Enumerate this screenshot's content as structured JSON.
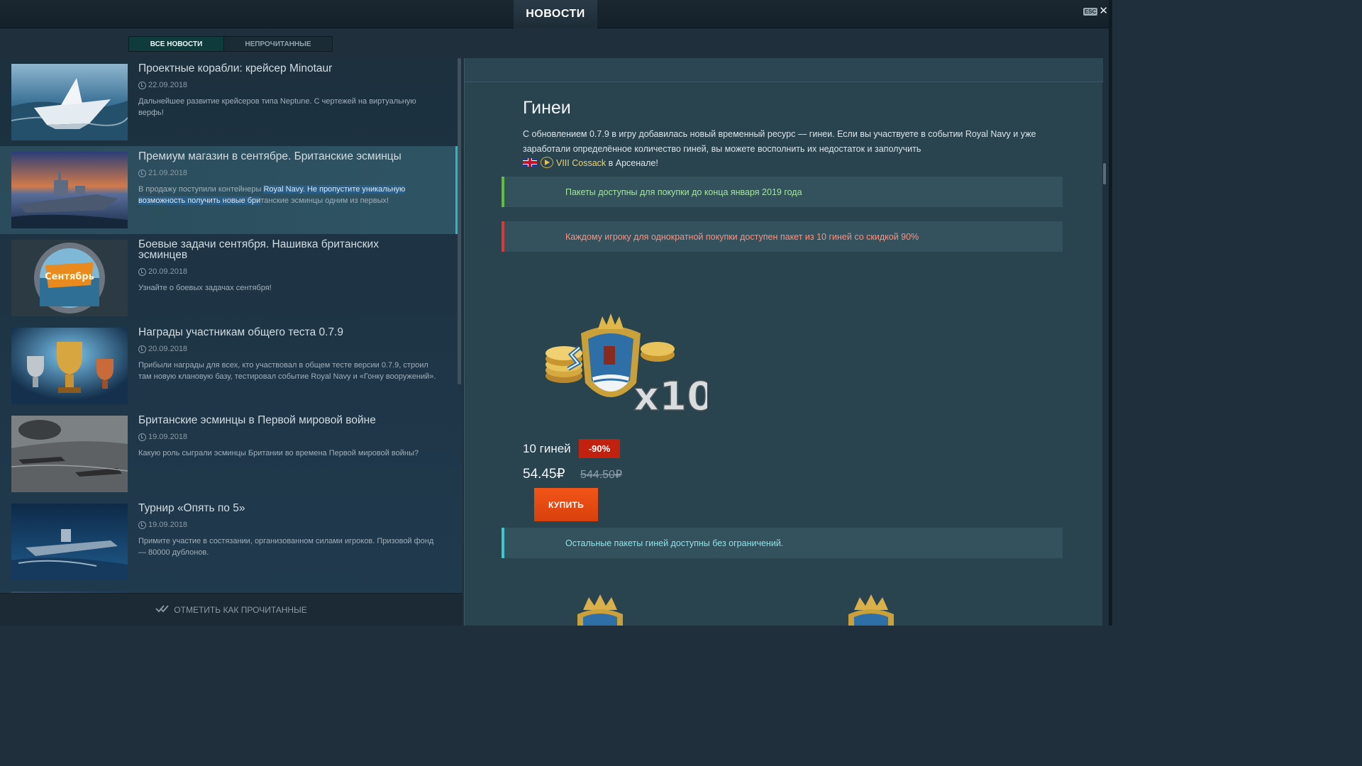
{
  "header": {
    "title": "НОВОСТИ",
    "esc": "ESC"
  },
  "tabs": [
    {
      "label": "ВСЕ НОВОСТИ",
      "active": true
    },
    {
      "label": "НЕПРОЧИТАННЫЕ",
      "active": false
    }
  ],
  "news": [
    {
      "title": "Проектные корабли: крейсер Minotaur",
      "date": "22.09.2018",
      "desc": "Дальнейшее развитие крейсеров типа Neptune. С чертежей на виртуальную верфь!"
    },
    {
      "title": "Премиум магазин в сентябре. Британские эсминцы",
      "date": "21.09.2018",
      "desc_plain": "В продажу поступили контейнеры ",
      "desc_highlight": "Royal Navy. Не пропустите уникальную возможность получить новые бри",
      "desc_rest": "танские эсминцы одним из первых!",
      "selected": true
    },
    {
      "title": "Боевые задачи сентября. Нашивка британских эсминцев",
      "date": "20.09.2018",
      "desc": "Узнайте о боевых задачах сентября!",
      "thumb_text": "Сентябрь"
    },
    {
      "title": "Награды участникам общего теста 0.7.9",
      "date": "20.09.2018",
      "desc": "Прибыли награды для всех, кто участвовал в общем тесте версии 0.7.9, строил там новую клановую базу, тестировал событие Royal Navy и «Гонку вооружений»."
    },
    {
      "title": "Британские эсминцы в Первой мировой войне",
      "date": "19.09.2018",
      "desc": "Какую роль сыграли эсминцы Британии во времена Первой мировой войны?"
    },
    {
      "title": "Турнир «Опять по 5»",
      "date": "19.09.2018",
      "desc": "Примите участие в состязании, организованном силами игроков. Призовой фонд — 80000 дублонов."
    }
  ],
  "mark_read": "ОТМЕТИТЬ КАК ПРОЧИТАННЫЕ",
  "article": {
    "title": "Гинеи",
    "body_1": "С обновлением 0.7.9 в игру добавилась новый временный ресурс — гинеи. Если вы участвуете в событии Royal Navy и уже заработали определённое количество гиней, вы можете восполнить их недостаток и заполучить",
    "ship": "VIII Cossack",
    "body_2": " в Арсенале!",
    "notice_green": "Пакеты доступны для покупки до конца января 2019 года",
    "notice_red": "Каждому игроку для однократной покупки доступен пакет из 10 гиней со скидкой 90%",
    "product_multiplier": "x10",
    "product_name": "10 гиней",
    "discount": "-90%",
    "price_new": "54.45₽",
    "price_old": "544.50₽",
    "buy": "КУПИТЬ",
    "notice_cyan": "Остальные пакеты гиней доступны без ограничений."
  },
  "colors": {
    "accent_buy": "#e84a12",
    "discount": "#c2210f",
    "notice_green": "#5fbf3a",
    "notice_red": "#d83a3a",
    "notice_cyan": "#3fc7cf"
  }
}
